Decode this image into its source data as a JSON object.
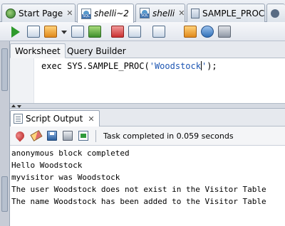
{
  "editor_tabs": [
    {
      "label": "Start Page",
      "close": "✕",
      "icon": "start-page-icon"
    },
    {
      "label": "shelli~2",
      "close": "✕",
      "icon": "sql-worksheet-icon",
      "active": true,
      "italic": true
    },
    {
      "label": "shelli",
      "close": "✕",
      "icon": "sql-worksheet-icon",
      "italic": true
    },
    {
      "label": "SAMPLE_PROC",
      "close": "✕",
      "icon": "procedure-icon"
    },
    {
      "label": "",
      "icon": "more-tabs-icon"
    }
  ],
  "toolbar": {
    "icons": [
      "run-statement-icon",
      "run-script-icon",
      "commit-icon",
      "dropdown-arrow-icon",
      "autotrace-icon",
      "explain-plan-icon",
      "rollback-icon",
      "cancel-icon",
      "sql-tuning-icon",
      "clear-icon",
      "history-icon",
      "format-icon"
    ]
  },
  "worksheet_tabs": [
    {
      "label": "Worksheet",
      "active": true
    },
    {
      "label": "Query Builder"
    }
  ],
  "editor": {
    "line_prefix": "exec SYS.SAMPLE_PROC(",
    "line_string_before_caret": "'Woodstock",
    "line_string_after_caret": "'",
    "line_suffix": ");"
  },
  "output_panel": {
    "tab_label": "Script Output",
    "close": "✕",
    "status": "Task completed in 0.059 seconds",
    "lines": [
      "anonymous block completed",
      "Hello Woodstock",
      "myvisitor was Woodstock",
      "The user Woodstock does not exist in the Visitor Table",
      "The name Woodstock has been added to the Visitor Table"
    ]
  },
  "colors": {
    "run_green": "#2e9a2c",
    "string_literal": "#1d56b3",
    "chrome_bg": "#d7dbe2"
  }
}
